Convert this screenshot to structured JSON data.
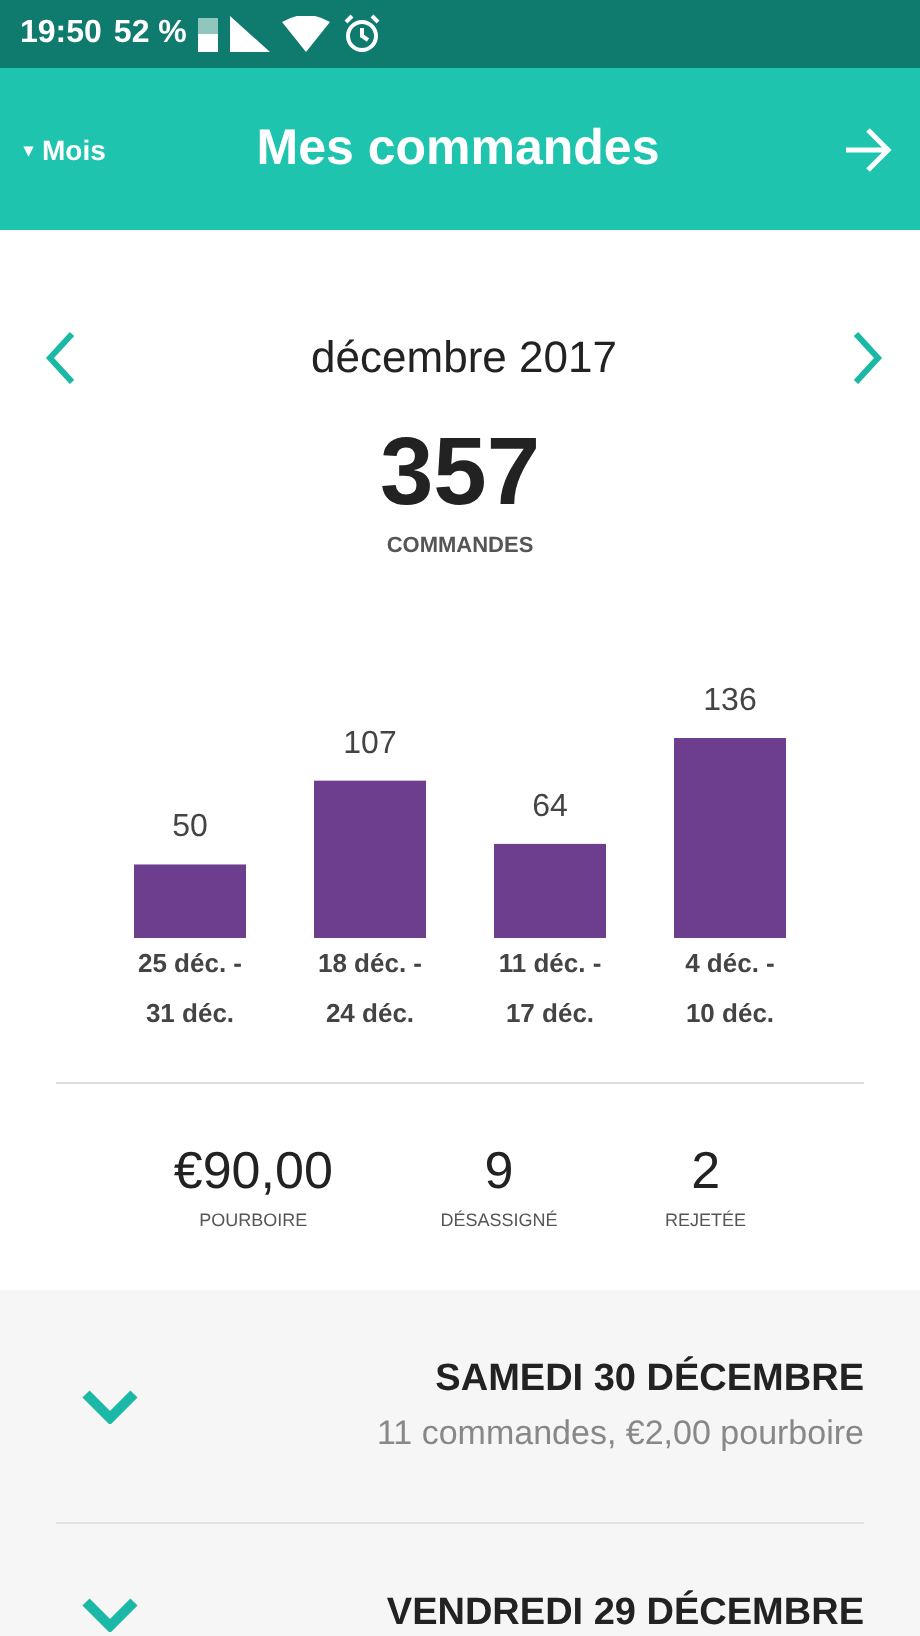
{
  "status_bar": {
    "time": "19:50",
    "battery": "52 %"
  },
  "header": {
    "period": "Mois",
    "period_caret": "▾",
    "title": "Mes commandes"
  },
  "month_nav": {
    "label": "décembre 2017"
  },
  "total": {
    "value": "357",
    "label": "COMMANDES"
  },
  "chart": {
    "chart_data": {
      "type": "bar",
      "categories": [
        "25 déc. - 31 déc.",
        "18 déc. - 24 déc.",
        "11 déc. - 17 déc.",
        "4 déc. - 10 déc."
      ],
      "values": [
        50,
        107,
        64,
        136
      ],
      "data_labels": true
    }
  },
  "stats": [
    {
      "value": "€90,00",
      "label": "POURBOIRE"
    },
    {
      "value": "9",
      "label": "DÉSASSIGNÉ"
    },
    {
      "value": "2",
      "label": "REJETÉE"
    }
  ],
  "days": [
    {
      "title": "SAMEDI 30 DÉCEMBRE",
      "summary": "11 commandes, €2,00 pourboire",
      "expanded": false
    },
    {
      "title": "VENDREDI 29 DÉCEMBRE",
      "expanded": false
    }
  ]
}
